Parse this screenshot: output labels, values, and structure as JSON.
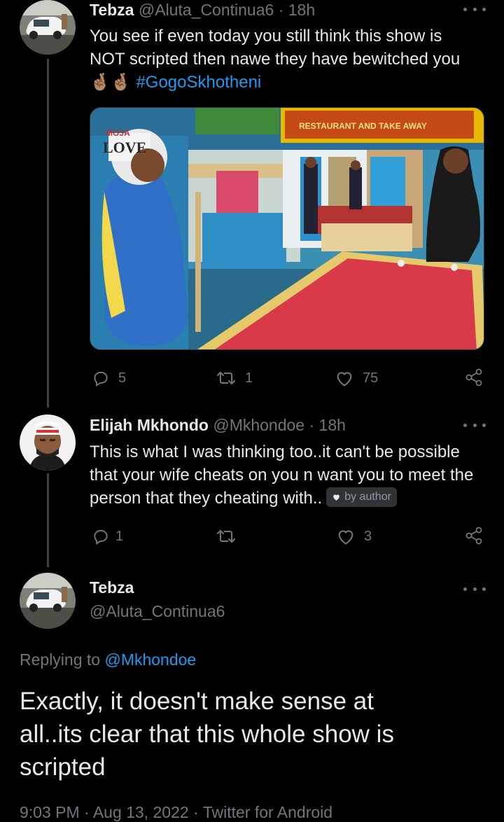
{
  "tweet1": {
    "name": "Tebza",
    "handle": "@Aluta_Continua6",
    "time": "· 18h",
    "text_line1": "You see if even today you still think this show is",
    "text_line2": "NOT scripted then nawe they have bewitched you",
    "emoji": "🤞🏽🤞🏽",
    "hashtag": "#GogoSkhotheni",
    "replies": "5",
    "retweets": "1",
    "likes": "75",
    "media_sign_1": "MOJA",
    "media_sign_2": "LOVE",
    "media_sign_3": "RESTAURANT AND TAKE AWAY"
  },
  "tweet2": {
    "name": "Elijah Mkhondo",
    "handle": "@Mkhondoe",
    "time": "· 18h",
    "text_line1": "This is what I was thinking too..it can't be possible",
    "text_line2": "that your wife cheats on you n want you to meet the",
    "text_line3": "person that they cheating with..",
    "badge": "by author",
    "replies": "1",
    "retweets": "",
    "likes": "3"
  },
  "main": {
    "name": "Tebza",
    "handle": "@Aluta_Continua6",
    "replying_prefix": "Replying to",
    "replying_to": "@Mkhondoe",
    "text_line1": "Exactly, it doesn't make sense at",
    "text_line2": "all..its clear that this whole show is",
    "text_line3": "scripted",
    "meta": "9:03 PM · Aug 13, 2022 · Twitter for Android"
  },
  "colors": {
    "background": "#000000",
    "text": "#e7e9ea",
    "muted": "#71767b",
    "link": "#1d9bf0",
    "thread_line": "#3e4144"
  }
}
